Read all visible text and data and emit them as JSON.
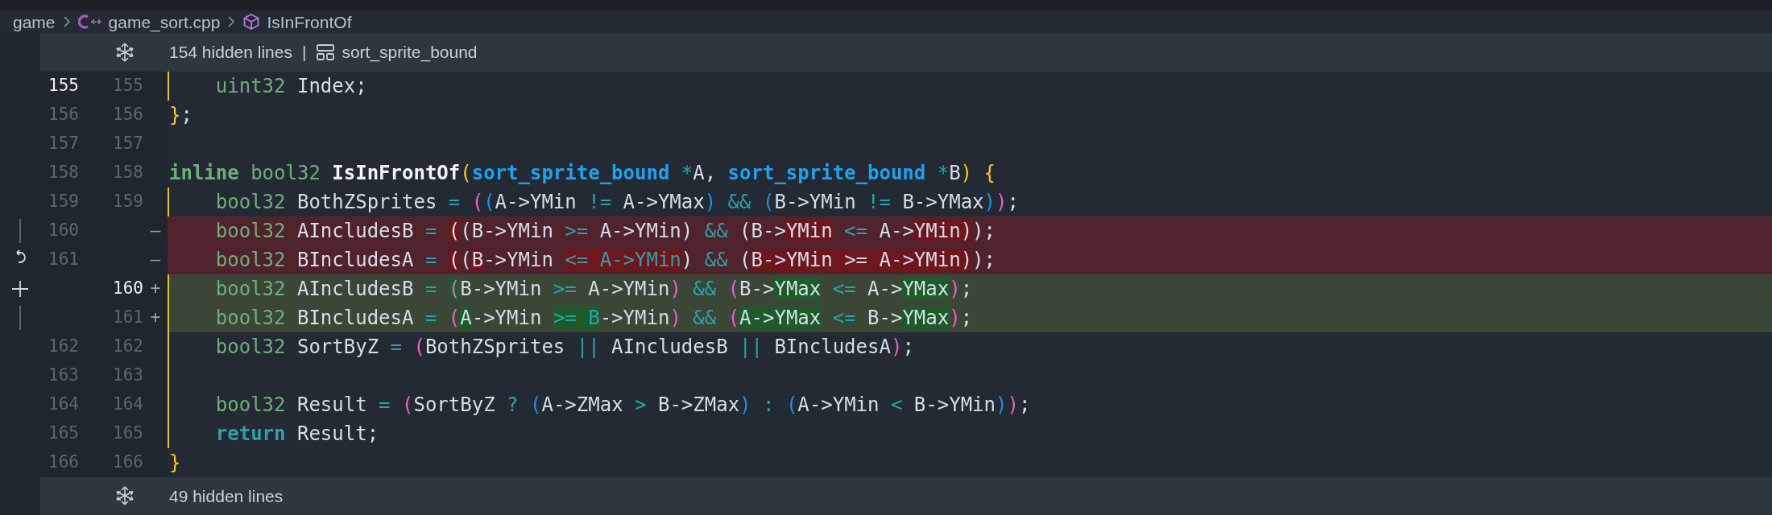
{
  "breadcrumb": [
    {
      "kind": "folder",
      "text": "game"
    },
    {
      "kind": "cpp",
      "text": "game_sort.cpp"
    },
    {
      "kind": "symbol",
      "text": "IsInFrontOf"
    }
  ],
  "hidden_top": {
    "text": "154 hidden lines",
    "separator": "|",
    "symbol": "sort_sprite_bound"
  },
  "lines": [
    {
      "old": {
        "number": "155",
        "current": true
      },
      "new": {
        "number": "155",
        "current": false
      },
      "kind": "context",
      "modified": true,
      "tokens": [
        {
          "kind": "type",
          "text": "    uint32"
        },
        {
          "kind": "id",
          "text": " Index;"
        }
      ]
    },
    {
      "old": {
        "number": "156",
        "current": false
      },
      "new": {
        "number": "156",
        "current": false
      },
      "kind": "context",
      "modified": false,
      "tokens": [
        {
          "kind": "p1",
          "text": "}"
        },
        {
          "kind": "id",
          "text": ";"
        }
      ]
    },
    {
      "old": {
        "number": "157",
        "current": false
      },
      "new": {
        "number": "157",
        "current": false
      },
      "kind": "context",
      "modified": false
    },
    {
      "old": {
        "number": "158",
        "current": false
      },
      "new": {
        "number": "158",
        "current": false
      },
      "kind": "context",
      "modified": false,
      "tokens": [
        {
          "kind": "kw",
          "text": "inline"
        },
        {
          "kind": "type",
          "text": " bool32"
        },
        {
          "kind": "fn",
          "text": " IsInFrontOf"
        },
        {
          "kind": "p1",
          "text": "("
        },
        {
          "kind": "ptype",
          "text": "sort_sprite_bound"
        },
        {
          "kind": "op",
          "text": " *"
        },
        {
          "kind": "id",
          "text": "A,"
        },
        {
          "kind": "ptype",
          "text": " sort_sprite_bound"
        },
        {
          "kind": "op",
          "text": " *"
        },
        {
          "kind": "id",
          "text": "B"
        },
        {
          "kind": "p1",
          "text": ")"
        },
        {
          "kind": "p1",
          "text": " {"
        }
      ]
    },
    {
      "old": {
        "number": "159",
        "current": false
      },
      "new": {
        "number": "159",
        "current": false
      },
      "kind": "context",
      "modified": true,
      "tokens": [
        {
          "kind": "type",
          "text": "    bool32"
        },
        {
          "kind": "id",
          "text": " BothZSprites"
        },
        {
          "kind": "op",
          "text": " ="
        },
        {
          "kind": "p2",
          "text": " ("
        },
        {
          "kind": "p3",
          "text": "("
        },
        {
          "kind": "id",
          "text": "A->YMin"
        },
        {
          "kind": "op",
          "text": " !="
        },
        {
          "kind": "id",
          "text": " A->YMax"
        },
        {
          "kind": "p3",
          "text": ")"
        },
        {
          "kind": "op",
          "text": " &&"
        },
        {
          "kind": "p3",
          "text": " ("
        },
        {
          "kind": "id",
          "text": "B->YMin"
        },
        {
          "kind": "op",
          "text": " !="
        },
        {
          "kind": "id",
          "text": " B->YMax"
        },
        {
          "kind": "p3",
          "text": ")"
        },
        {
          "kind": "p2",
          "text": ")"
        },
        {
          "kind": "id",
          "text": ";"
        }
      ]
    },
    {
      "old": {
        "number": "160",
        "current": false
      },
      "sign": "—",
      "kind": "deleted",
      "modified": false,
      "gutter": {
        "kind": "bar"
      },
      "tokens": [
        {
          "kind": "type",
          "text": "    bool32"
        },
        {
          "kind": "id",
          "text": " AIncludesB"
        },
        {
          "kind": "op",
          "text": " = "
        },
        {
          "kind": "id",
          "text": "(",
          "changed": true
        },
        {
          "kind": "id",
          "text": "(B->YMin"
        },
        {
          "kind": "op",
          "text": " >="
        },
        {
          "kind": "id",
          "text": " A->YMin)"
        },
        {
          "kind": "op",
          "text": " &&"
        },
        {
          "kind": "id",
          "text": " (B->"
        },
        {
          "kind": "id",
          "text": "YMin",
          "changed": true
        },
        {
          "kind": "op",
          "text": " <="
        },
        {
          "kind": "id",
          "text": " A->"
        },
        {
          "kind": "id",
          "text": "YMin)",
          "changed": true
        },
        {
          "kind": "id",
          "text": ");"
        }
      ]
    },
    {
      "old": {
        "number": "161",
        "current": false
      },
      "sign": "—",
      "kind": "deleted",
      "modified": false,
      "gutter": {
        "kind": "revert"
      },
      "tokens": [
        {
          "kind": "type",
          "text": "    bool32"
        },
        {
          "kind": "id",
          "text": " BIncludesA"
        },
        {
          "kind": "op",
          "text": " = "
        },
        {
          "kind": "id",
          "text": "(",
          "changed": true
        },
        {
          "kind": "id",
          "text": "("
        },
        {
          "kind": "id",
          "text": "B",
          "changed": true
        },
        {
          "kind": "id",
          "text": "->YMin "
        },
        {
          "kind": "op",
          "text": "<= A->YMin",
          "changed": true
        },
        {
          "kind": "id",
          "text": ") "
        },
        {
          "kind": "op",
          "text": "&&"
        },
        {
          "kind": "id",
          "text": " ("
        },
        {
          "kind": "id",
          "text": "B->YMin >= A->YMin)",
          "changed": true
        },
        {
          "kind": "id",
          "text": ");"
        }
      ]
    },
    {
      "new": {
        "number": "160",
        "current": true
      },
      "sign": "+",
      "kind": "added",
      "modified": true,
      "gutter": {
        "kind": "add"
      },
      "tokens": [
        {
          "kind": "type",
          "text": "    bool32"
        },
        {
          "kind": "id",
          "text": " AIncludesB"
        },
        {
          "kind": "op",
          "text": " = "
        },
        {
          "kind": "p2",
          "text": "(",
          "changed": true
        },
        {
          "kind": "id",
          "text": "B->YMin"
        },
        {
          "kind": "op",
          "text": " >="
        },
        {
          "kind": "id",
          "text": " A->YMin"
        },
        {
          "kind": "p2",
          "text": ")"
        },
        {
          "kind": "op",
          "text": " &&"
        },
        {
          "kind": "p2",
          "text": " ("
        },
        {
          "kind": "id",
          "text": "B->"
        },
        {
          "kind": "id",
          "text": "YMax",
          "changed": true
        },
        {
          "kind": "op",
          "text": " <="
        },
        {
          "kind": "id",
          "text": " A->"
        },
        {
          "kind": "id",
          "text": "YMax",
          "changed": true
        },
        {
          "kind": "p2",
          "text": ")"
        },
        {
          "kind": "id",
          "text": ";"
        }
      ]
    },
    {
      "new": {
        "number": "161",
        "current": false
      },
      "sign": "+",
      "kind": "added",
      "modified": true,
      "gutter": {
        "kind": "bar"
      },
      "tokens": [
        {
          "kind": "type",
          "text": "    bool32"
        },
        {
          "kind": "id",
          "text": " BIncludesA"
        },
        {
          "kind": "op",
          "text": " ="
        },
        {
          "kind": "p2",
          "text": " ("
        },
        {
          "kind": "id",
          "text": "A",
          "changed": true
        },
        {
          "kind": "id",
          "text": "->YMin "
        },
        {
          "kind": "op",
          "text": ">= B",
          "changed": true
        },
        {
          "kind": "id",
          "text": "->YMin"
        },
        {
          "kind": "p2",
          "text": ")"
        },
        {
          "kind": "op",
          "text": " &&"
        },
        {
          "kind": "p2",
          "text": " ("
        },
        {
          "kind": "id",
          "text": "A->YMax",
          "changed": true
        },
        {
          "kind": "op",
          "text": " <="
        },
        {
          "kind": "id",
          "text": " B->"
        },
        {
          "kind": "id",
          "text": "YMax",
          "changed": true
        },
        {
          "kind": "p2",
          "text": ")"
        },
        {
          "kind": "id",
          "text": ";"
        }
      ]
    },
    {
      "old": {
        "number": "162",
        "current": false
      },
      "new": {
        "number": "162",
        "current": false
      },
      "kind": "context",
      "modified": true,
      "tokens": [
        {
          "kind": "type",
          "text": "    bool32"
        },
        {
          "kind": "id",
          "text": " SortByZ"
        },
        {
          "kind": "op",
          "text": " ="
        },
        {
          "kind": "p2",
          "text": " ("
        },
        {
          "kind": "id",
          "text": "BothZSprites"
        },
        {
          "kind": "op",
          "text": " ||"
        },
        {
          "kind": "id",
          "text": " AIncludesB"
        },
        {
          "kind": "op",
          "text": " ||"
        },
        {
          "kind": "id",
          "text": " BIncludesA"
        },
        {
          "kind": "p2",
          "text": ")"
        },
        {
          "kind": "id",
          "text": ";"
        }
      ]
    },
    {
      "old": {
        "number": "163",
        "current": false
      },
      "new": {
        "number": "163",
        "current": false
      },
      "kind": "context",
      "modified": true
    },
    {
      "old": {
        "number": "164",
        "current": false
      },
      "new": {
        "number": "164",
        "current": false
      },
      "kind": "context",
      "modified": true,
      "tokens": [
        {
          "kind": "type",
          "text": "    bool32"
        },
        {
          "kind": "id",
          "text": " Result"
        },
        {
          "kind": "op",
          "text": " ="
        },
        {
          "kind": "p2",
          "text": " ("
        },
        {
          "kind": "id",
          "text": "SortByZ"
        },
        {
          "kind": "op",
          "text": " ?"
        },
        {
          "kind": "p3",
          "text": " ("
        },
        {
          "kind": "id",
          "text": "A->ZMax"
        },
        {
          "kind": "op",
          "text": " >"
        },
        {
          "kind": "id",
          "text": " B->ZMax"
        },
        {
          "kind": "p3",
          "text": ")"
        },
        {
          "kind": "op",
          "text": " :"
        },
        {
          "kind": "p3",
          "text": " ("
        },
        {
          "kind": "id",
          "text": "A->YMin"
        },
        {
          "kind": "op",
          "text": " <"
        },
        {
          "kind": "id",
          "text": " B->YMin"
        },
        {
          "kind": "p3",
          "text": ")"
        },
        {
          "kind": "p2",
          "text": ")"
        },
        {
          "kind": "id",
          "text": ";"
        }
      ]
    },
    {
      "old": {
        "number": "165",
        "current": false
      },
      "new": {
        "number": "165",
        "current": false
      },
      "kind": "context",
      "modified": true,
      "tokens": [
        {
          "kind": "ret",
          "text": "    return"
        },
        {
          "kind": "id",
          "text": " Result;"
        }
      ]
    },
    {
      "old": {
        "number": "166",
        "current": false
      },
      "new": {
        "number": "166",
        "current": false
      },
      "kind": "context",
      "modified": false,
      "tokens": [
        {
          "kind": "p1",
          "text": "}"
        }
      ]
    }
  ],
  "hidden_bottom": {
    "text": "49 hidden lines"
  }
}
